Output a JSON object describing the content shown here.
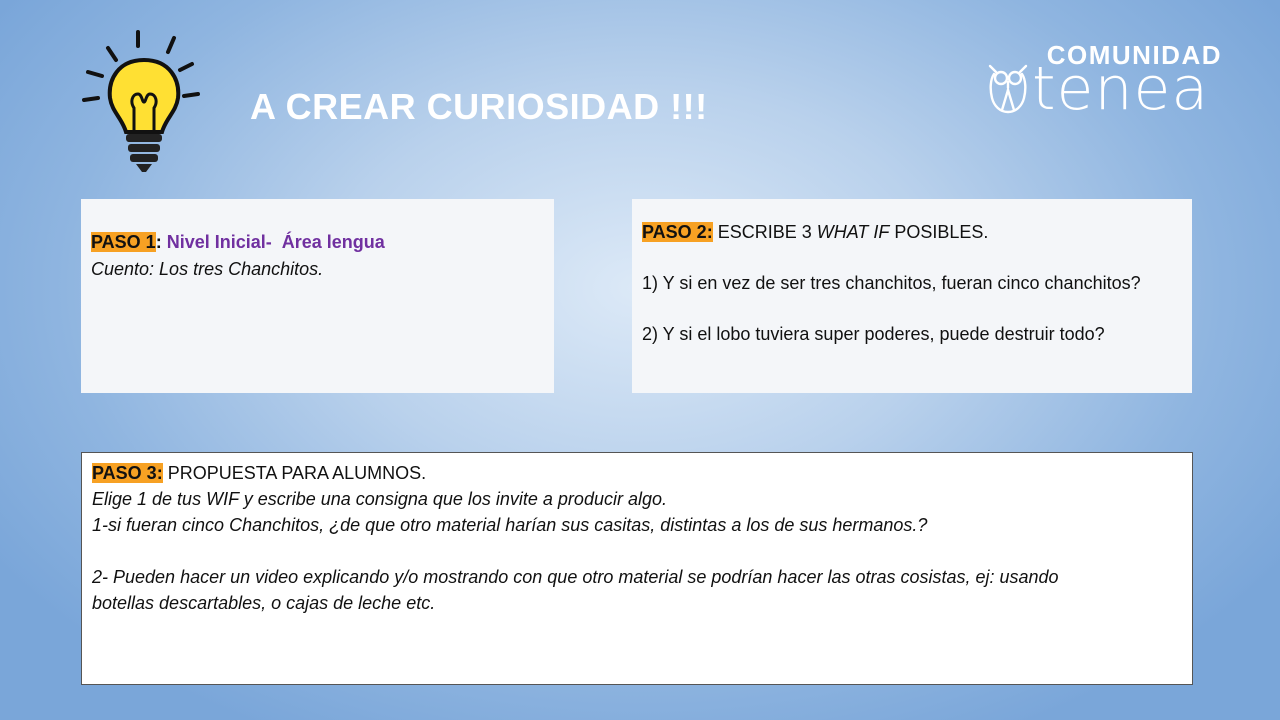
{
  "slide": {
    "title": "A CREAR CURIOSIDAD !!!"
  },
  "logo": {
    "top": "COMUNIDAD",
    "bottom": "tenea"
  },
  "paso1": {
    "label": "PASO 1",
    "colon": ":",
    "level": "Nivel Inicial-",
    "area": "Área lengua",
    "story": "Cuento: Los tres Chanchitos."
  },
  "paso2": {
    "label": "PASO 2:",
    "heading_pre": " ESCRIBE  3 ",
    "heading_em": "WHAT IF",
    "heading_post": " POSIBLES.",
    "items": [
      "1) Y si en vez de ser tres chanchitos, fueran cinco chanchitos?",
      "2) Y si el lobo tuviera super poderes, puede destruir  todo?"
    ]
  },
  "paso3": {
    "label": "PASO 3:",
    "heading": " PROPUESTA  PARA ALUMNOS.",
    "line1": "Elige 1 de tus WIF y escribe una consigna que los invite a producir algo.",
    "line2": "1-si fueran cinco Chanchitos, ¿de que otro material harían sus casitas, distintas a los de sus hermanos.?",
    "line3": "2-   Pueden hacer un video explicando y/o mostrando con que otro material se podrían hacer las otras cosistas, ej: usando",
    "line4": "botellas descartables, o cajas de leche etc."
  },
  "colors": {
    "highlight": "#f7a123",
    "purple": "#7030a0",
    "title": "#ffffff"
  }
}
